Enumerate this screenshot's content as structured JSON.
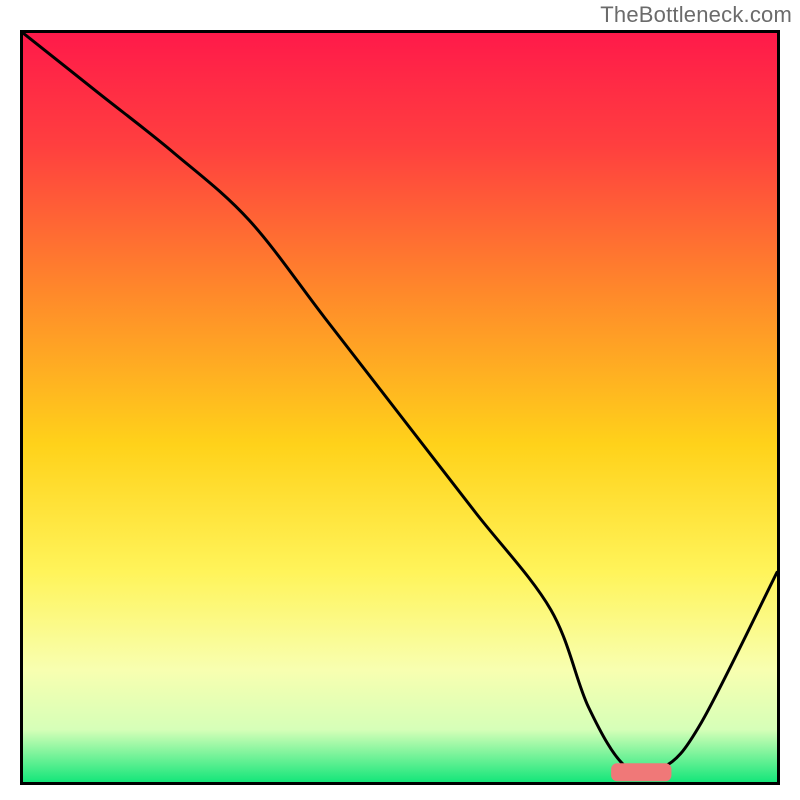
{
  "watermark": "TheBottleneck.com",
  "chart_data": {
    "type": "line",
    "title": "",
    "xlabel": "",
    "ylabel": "",
    "xlim": [
      0,
      100
    ],
    "ylim": [
      0,
      100
    ],
    "grid": false,
    "series": [
      {
        "name": "bottleneck-curve",
        "x": [
          0,
          10,
          20,
          30,
          40,
          50,
          60,
          70,
          75,
          80,
          85,
          90,
          100
        ],
        "y": [
          100,
          92,
          84,
          75,
          62,
          49,
          36,
          23,
          10,
          2,
          2,
          8,
          28
        ]
      }
    ],
    "annotations": [
      {
        "name": "optimal-range-bar",
        "type": "bar",
        "x_range": [
          78,
          86
        ],
        "y": 1.3,
        "color": "#f07878"
      }
    ],
    "background_gradient": {
      "type": "vertical",
      "stops": [
        {
          "pos": 0.0,
          "color": "#ff1a4a"
        },
        {
          "pos": 0.15,
          "color": "#ff3f3f"
        },
        {
          "pos": 0.35,
          "color": "#ff8a2a"
        },
        {
          "pos": 0.55,
          "color": "#ffd21a"
        },
        {
          "pos": 0.72,
          "color": "#fff45a"
        },
        {
          "pos": 0.85,
          "color": "#f8ffb0"
        },
        {
          "pos": 0.93,
          "color": "#d6ffb8"
        },
        {
          "pos": 1.0,
          "color": "#15e67a"
        }
      ]
    }
  }
}
